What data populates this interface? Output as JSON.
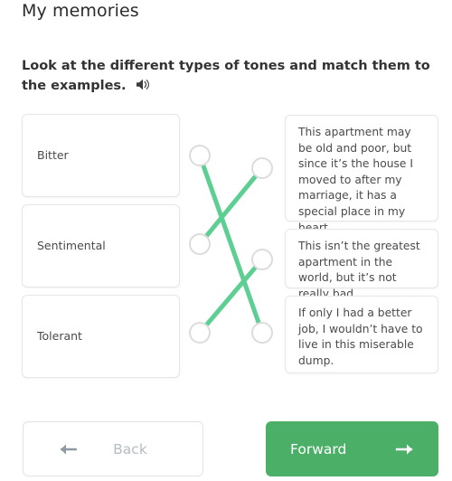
{
  "header": {
    "title": "My memories",
    "instruction_line1": "Look at the different types of tones and match them to",
    "instruction_line2": "the examples.",
    "audio_icon": "speaker-icon"
  },
  "colors": {
    "accent_green": "#4caf68",
    "connector_green": "#5ecf92",
    "card_border": "#e6e6e6",
    "node_stroke": "#dcdcdc",
    "back_label": "#b6bdc2",
    "text": "#4a4a4a"
  },
  "matching": {
    "left_items": [
      {
        "id": "left-0",
        "label": "Bitter"
      },
      {
        "id": "left-1",
        "label": "Sentimental"
      },
      {
        "id": "left-2",
        "label": "Tolerant"
      }
    ],
    "right_items": [
      {
        "id": "right-0",
        "label": "This apartment may be old and poor, but since it’s the house I moved to after my marriage, it has a special place in my heart."
      },
      {
        "id": "right-1",
        "label": "This isn’t the greatest apartment in the world, but it’s not really bad."
      },
      {
        "id": "right-2",
        "label": "If only I had a better job, I wouldn’t have to live in this miserable dump."
      }
    ],
    "connections": [
      {
        "from": 0,
        "to": 2
      },
      {
        "from": 1,
        "to": 0
      },
      {
        "from": 2,
        "to": 1
      }
    ]
  },
  "footer": {
    "back_label": "Back",
    "back_icon": "arrow-left-icon",
    "forward_label": "Forward",
    "forward_icon": "arrow-right-icon"
  }
}
